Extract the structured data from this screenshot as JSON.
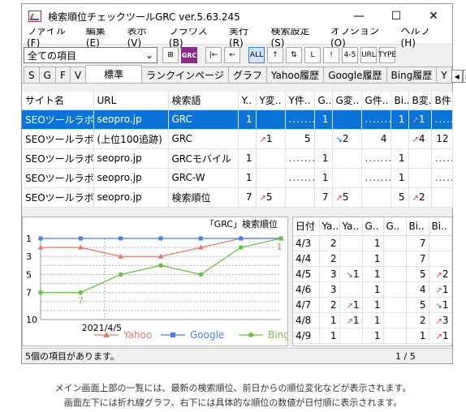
{
  "window": {
    "title": "検索順位チェックツールGRC  ver.5.63.245",
    "controls": {
      "minimize": "—",
      "maximize": "☐",
      "close": "✕"
    }
  },
  "menu": [
    "ファイル(F)",
    "編集(E)",
    "表示(V)",
    "ブラウズ(B)",
    "実行(R)",
    "検索設定(S)",
    "オプション(O)",
    "ヘルプ(H)"
  ],
  "toolbar": {
    "filter_value": "全ての項目",
    "buttons": [
      {
        "name": "add-window-icon",
        "label": "⊞"
      },
      {
        "name": "grc-icon",
        "label": "GRC"
      },
      {
        "name": "first-icon",
        "label": "|←"
      },
      {
        "name": "back-icon",
        "label": "←"
      },
      {
        "name": "all-icon",
        "label": "ALL"
      },
      {
        "name": "up-icon",
        "label": "↑"
      },
      {
        "name": "updown-icon",
        "label": "⇅"
      },
      {
        "name": "down-left-icon",
        "label": "L"
      },
      {
        "name": "exclaim-icon",
        "label": "!"
      },
      {
        "name": "range-icon",
        "label": "4-5"
      },
      {
        "name": "url-icon",
        "label": "URL"
      },
      {
        "name": "type-icon",
        "label": "TYPE"
      }
    ]
  },
  "tabs": [
    "S",
    "G",
    "F",
    "V",
    "標準",
    "ランクインページ",
    "グラフ",
    "Yahoo履歴",
    "Google履歴",
    "Bing履歴",
    "Y"
  ],
  "grid": {
    "columns": [
      "サイト名",
      "URL",
      "検索語",
      "Y..",
      "Y変..",
      "Y件..",
      "G..",
      "G変..",
      "G件..",
      "Bi..",
      "B変..",
      "B件.."
    ],
    "rows": [
      [
        "SEOツールラボ",
        "seopro.jp",
        "GRC",
        "1",
        "",
        "........",
        "1",
        "",
        "........",
        "1",
        "↗1",
        "........"
      ],
      [
        "SEOツールラボ",
        "(上位100追跡)",
        "GRC",
        "",
        "↗1",
        "5",
        "",
        "↘2",
        "4",
        "",
        "↗4",
        "12"
      ],
      [
        "SEOツールラボ",
        "seopro.jp",
        "GRCモバイル",
        "1",
        "",
        "........",
        "1",
        "",
        "........",
        "1",
        "",
        "........"
      ],
      [
        "SEOツールラボ",
        "seopro.jp",
        "GRC-W",
        "1",
        "",
        "........",
        "1",
        "",
        "........",
        "1",
        "",
        "........"
      ],
      [
        "SEOツールラボ",
        "seopro.jp",
        "検索順位",
        "7",
        "↗5",
        "",
        "7",
        "↗5",
        "",
        "5",
        "↗2",
        ""
      ]
    ]
  },
  "chart_data": {
    "type": "line",
    "title": "「GRC」検索順位",
    "x": [
      "4/3",
      "4/4",
      "4/5",
      "4/6",
      "4/7",
      "4/8",
      "4/9"
    ],
    "x_tick_label": "2021/4/5",
    "y_ticks": [
      1,
      3,
      5,
      7,
      10
    ],
    "ylim": [
      1,
      10
    ],
    "y_inverted": true,
    "series": [
      {
        "name": "Yahoo",
        "color": "#e07a6a",
        "values": [
          2,
          2,
          3,
          3,
          2,
          1,
          1
        ]
      },
      {
        "name": "Google",
        "color": "#4a7fe0",
        "values": [
          1,
          1,
          1,
          1,
          1,
          1,
          1
        ]
      },
      {
        "name": "Bing",
        "color": "#6cc04a",
        "values": [
          7,
          7,
          5,
          4,
          5,
          2,
          1
        ]
      }
    ],
    "point_labels": [
      {
        "series": "Bing",
        "index": 1,
        "text": "7"
      },
      {
        "series": "Yahoo",
        "index": 6,
        "text": "1"
      }
    ]
  },
  "history": {
    "columns": [
      "日付",
      "Ya..",
      "Ya..",
      "G..",
      "G..",
      "Bi..",
      "Bi.."
    ],
    "rows": [
      [
        "4/3",
        "2",
        "",
        "1",
        "",
        "7",
        ""
      ],
      [
        "4/4",
        "2",
        "",
        "1",
        "",
        "7",
        ""
      ],
      [
        "4/5",
        "3",
        "↘1",
        "1",
        "",
        "5",
        "↗2"
      ],
      [
        "4/6",
        "3",
        "",
        "1",
        "",
        "4",
        "↗1"
      ],
      [
        "4/7",
        "2",
        "↗1",
        "1",
        "",
        "5",
        "↘1"
      ],
      [
        "4/8",
        "1",
        "↗1",
        "1",
        "",
        "2",
        "↗3"
      ],
      [
        "4/9",
        "1",
        "",
        "1",
        "",
        "1",
        "↗1"
      ]
    ]
  },
  "status": {
    "text": "5個の項目があります。",
    "page": "1 / 5"
  },
  "caption": {
    "line1": "メイン画面上部の一覧には、最新の検索順位、前日からの順位変化などが表示されます。",
    "line2": "画面左下には折れ線グラフ、右下には具体的な順位の数値が日付順に表示されます。"
  }
}
